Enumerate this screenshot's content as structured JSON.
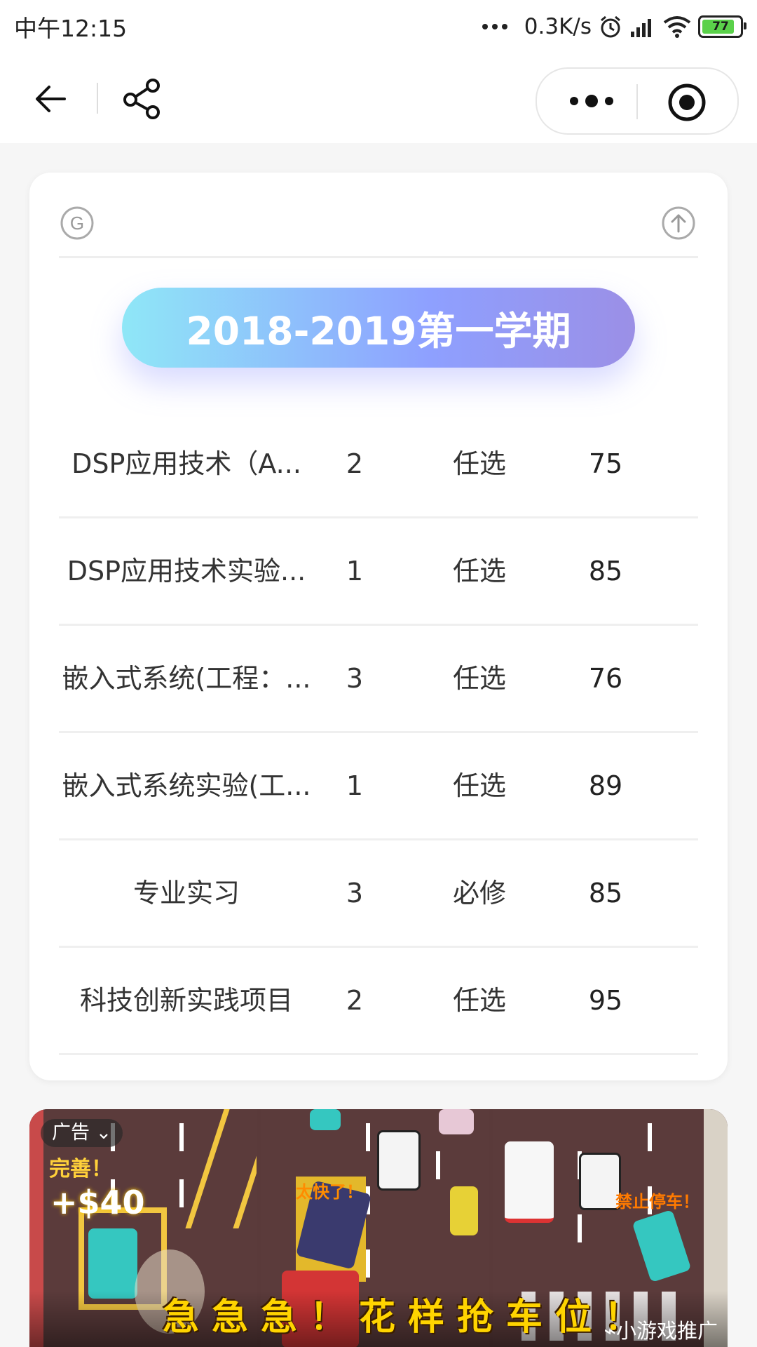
{
  "status_bar": {
    "time": "中午12:15",
    "net_speed": "0.3K/s",
    "battery": "77"
  },
  "card": {
    "term_label": "2018-2019第一学期",
    "courses": [
      {
        "name": "DSP应用技术（A...",
        "credit": "2",
        "type": "任选",
        "score": "75"
      },
      {
        "name": "DSP应用技术实验...",
        "credit": "1",
        "type": "任选",
        "score": "85"
      },
      {
        "name": "嵌入式系统(工程：...",
        "credit": "3",
        "type": "任选",
        "score": "76"
      },
      {
        "name": "嵌入式系统实验(工...",
        "credit": "1",
        "type": "任选",
        "score": "89"
      },
      {
        "name": "专业实习",
        "credit": "3",
        "type": "必修",
        "score": "85"
      },
      {
        "name": "科技创新实践项目",
        "credit": "2",
        "type": "任选",
        "score": "95"
      }
    ]
  },
  "ad": {
    "tag": "广告",
    "bonus_text": "完善！",
    "money_text": "+$40",
    "fast_text": "太快了！",
    "no_parking_text": "禁止停车！",
    "slogan": "急急急！花样抢车位！",
    "promo_label": "小游戏推广"
  }
}
